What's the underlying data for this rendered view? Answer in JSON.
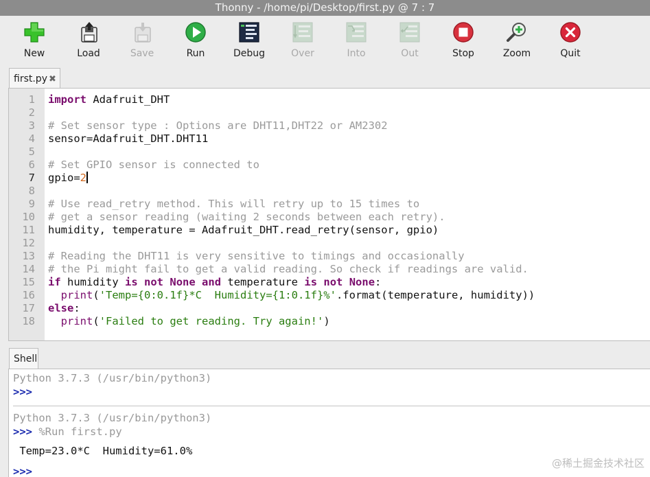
{
  "window": {
    "title": "Thonny  -  /home/pi/Desktop/first.py  @  7 : 7"
  },
  "toolbar": {
    "new": "New",
    "load": "Load",
    "save": "Save",
    "run": "Run",
    "debug": "Debug",
    "over": "Over",
    "into": "Into",
    "out": "Out",
    "stop": "Stop",
    "zoom": "Zoom",
    "quit": "Quit"
  },
  "colors": {
    "new": "#39c22b",
    "run": "#2fae47",
    "stop": "#d8323e",
    "quit": "#d9263a",
    "keyword": "#7a0d6d",
    "string": "#2a7d10",
    "comment": "#9a9a9a",
    "prompt": "#1d2db0"
  },
  "editor": {
    "tab_label": "first.py",
    "tab_close": "✖",
    "current_line": 7,
    "line_numbers": [
      "1",
      "2",
      "3",
      "4",
      "5",
      "6",
      "7",
      "8",
      "9",
      "10",
      "11",
      "12",
      "13",
      "14",
      "15",
      "16",
      "17",
      "18"
    ],
    "lines": {
      "l1": {
        "kw": "import",
        "rest": " Adafruit_DHT"
      },
      "l3": "# Set sensor type : Options are DHT11,DHT22 or AM2302",
      "l4": "sensor=Adafruit_DHT.DHT11",
      "l6": "# Set GPIO sensor is connected to",
      "l7": {
        "code": "gpio=",
        "num": "2"
      },
      "l9": "# Use read_retry method. This will retry up to 15 times to",
      "l10": "# get a sensor reading (waiting 2 seconds between each retry).",
      "l11": "humidity, temperature = Adafruit_DHT.read_retry(sensor, gpio)",
      "l13": "# Reading the DHT11 is very sensitive to timings and occasionally",
      "l14": "# the Pi might fail to get a valid reading. So check if readings are valid.",
      "l15": {
        "if": "if",
        "a": " humidity ",
        "is1": "is",
        "not1": "not",
        "none1": "None",
        "and": "and",
        "b": " temperature ",
        "is2": "is",
        "not2": "not",
        "none2": "None",
        "colon": ":"
      },
      "l16": {
        "indent": "  ",
        "fn": "print",
        "open": "(",
        "str": "'Temp={0:0.1f}*C  Humidity={1:0.1f}%'",
        "rest": ".format(temperature, humidity))"
      },
      "l17": {
        "kw": "else",
        "rest": ":"
      },
      "l18": {
        "indent": "  ",
        "fn": "print",
        "open": "(",
        "str": "'Failed to get reading. Try again!'",
        "close": ")"
      }
    }
  },
  "shell": {
    "tab_label": "Shell",
    "banner1": "Python 3.7.3 (/usr/bin/python3)",
    "prompt1": ">>>",
    "banner2": "Python 3.7.3 (/usr/bin/python3)",
    "prompt2": ">>>",
    "run_cmd": " %Run first.py",
    "output": " Temp=23.0*C  Humidity=61.0%",
    "prompt3": ">>>"
  },
  "watermark": "@稀土掘金技术社区"
}
